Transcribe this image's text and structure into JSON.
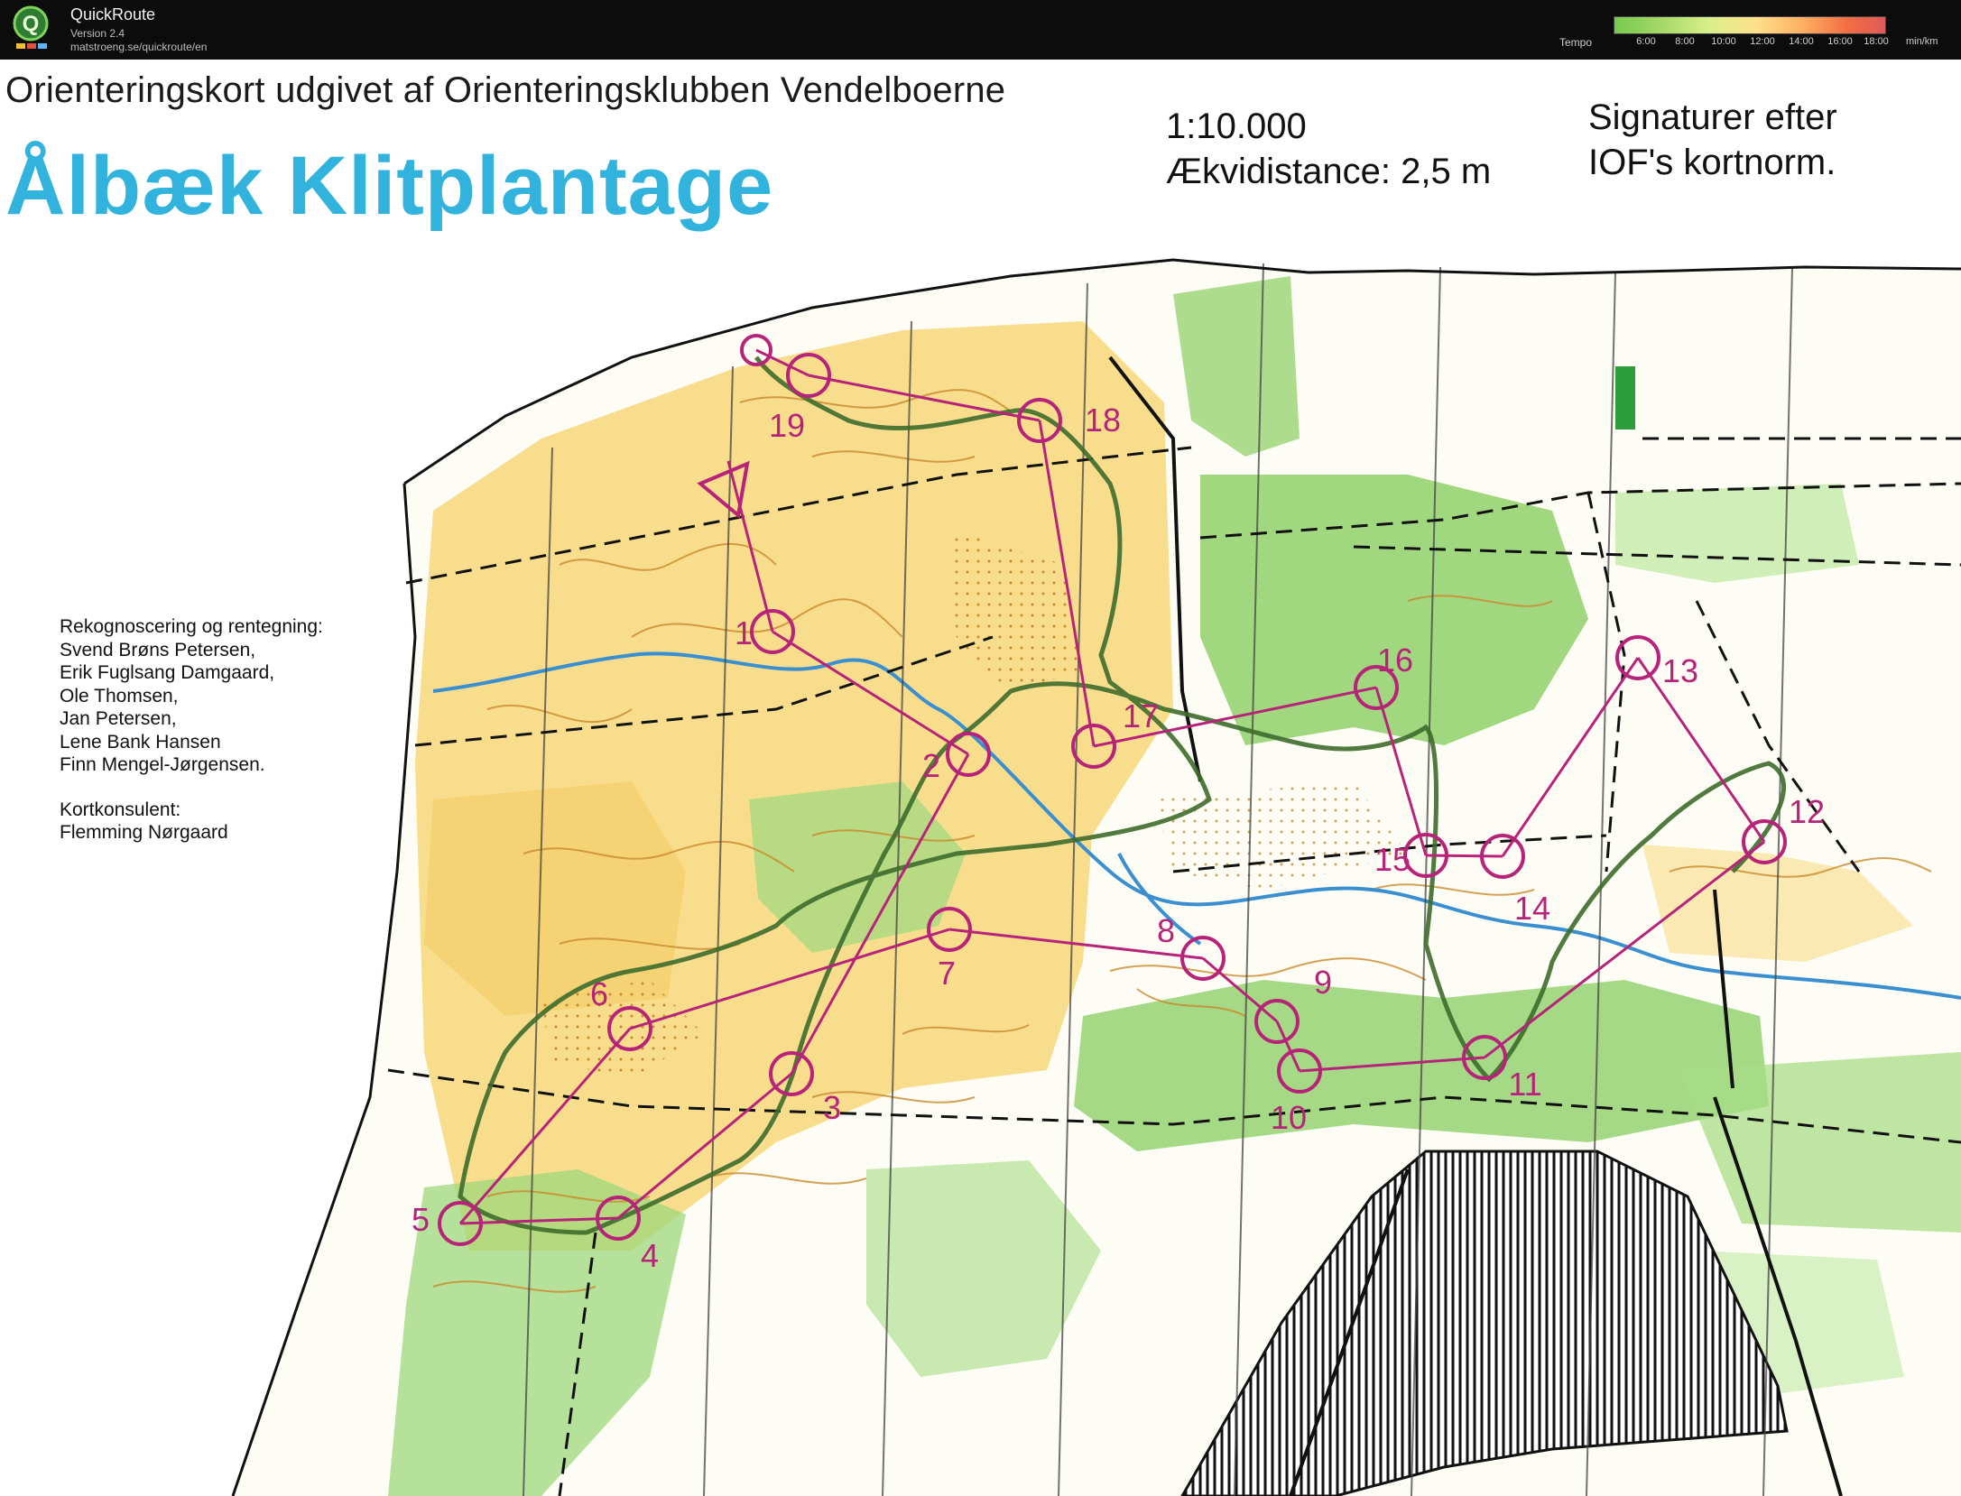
{
  "app": {
    "name": "QuickRoute",
    "version": "Version 2.4",
    "url": "matstroeng.se/quickroute/en"
  },
  "tempo": {
    "label": "Tempo",
    "ticks": [
      "6:00",
      "8:00",
      "10:00",
      "12:00",
      "14:00",
      "16:00",
      "18:00"
    ],
    "unit": "min/km",
    "colors": [
      "#78c850",
      "#d9ef8b",
      "#fee08b",
      "#fdae61",
      "#e05a5a"
    ]
  },
  "map": {
    "header": "Orienteringskort udgivet af Orienteringsklubben Vendelboerne",
    "title": "Ålbæk Klitplantage",
    "scale": "1:10.000",
    "equidistance": "Ækvidistance: 2,5 m",
    "symbols_line1": "Signaturer efter",
    "symbols_line2": "IOF's kortnorm.",
    "credits": {
      "heading": "Rekognoscering og rentegning:",
      "names": [
        "Svend Brøns Petersen,",
        "Erik Fuglsang Damgaard,",
        "Ole Thomsen,",
        "Jan Petersen,",
        "Lene Bank Hansen",
        "Finn Mengel-Jørgensen."
      ],
      "consultant_heading": "Kortkonsulent:",
      "consultant": "Flemming Nørgaard"
    },
    "controls": [
      "1",
      "2",
      "3",
      "4",
      "5",
      "6",
      "7",
      "8",
      "9",
      "10",
      "11",
      "12",
      "13",
      "14",
      "15",
      "16",
      "17",
      "18",
      "19"
    ],
    "colors": {
      "course": "#b8237a",
      "route": "#3e6b2c",
      "open_land": "#f7d77a",
      "forest": "#8fd06a",
      "contour": "#c98a2e",
      "water": "#3a8fd0",
      "title": "#31b3de"
    }
  }
}
